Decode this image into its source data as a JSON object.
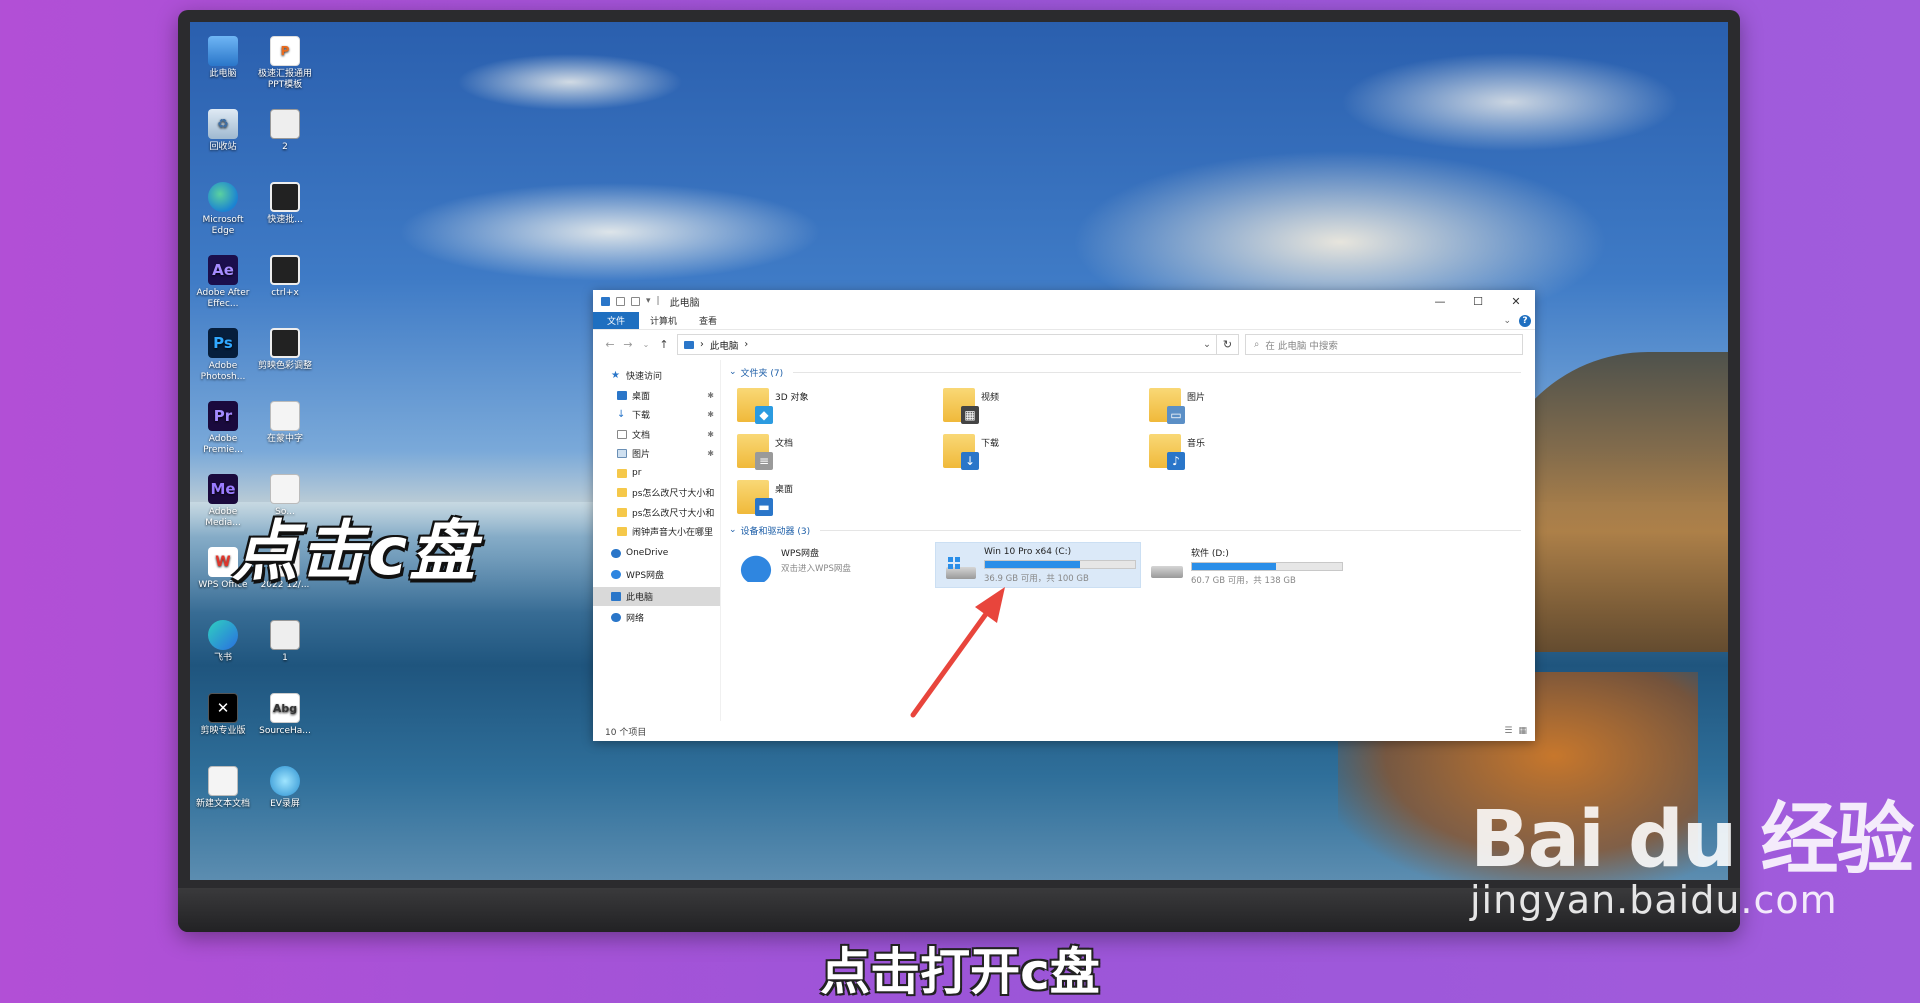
{
  "desktop_icons": [
    {
      "label": "此电脑",
      "icon": "pc",
      "glyph": ""
    },
    {
      "label": "极速汇报通用PPT模板",
      "icon": "ppt",
      "glyph": "P"
    },
    {
      "label": "回收站",
      "icon": "bin",
      "glyph": "♻"
    },
    {
      "label": "2",
      "icon": "img",
      "glyph": ""
    },
    {
      "label": "Microsoft Edge",
      "icon": "edge",
      "glyph": ""
    },
    {
      "label": "快速批...",
      "icon": "video",
      "glyph": ""
    },
    {
      "label": "Adobe After Effec...",
      "icon": "ae",
      "glyph": "Ae"
    },
    {
      "label": "ctrl+x",
      "icon": "video",
      "glyph": ""
    },
    {
      "label": "Adobe Photosh...",
      "icon": "ps",
      "glyph": "Ps"
    },
    {
      "label": "剪映色彩调整",
      "icon": "video",
      "glyph": ""
    },
    {
      "label": "Adobe Premie...",
      "icon": "pr",
      "glyph": "Pr"
    },
    {
      "label": "在蒙中字",
      "icon": "file",
      "glyph": ""
    },
    {
      "label": "Adobe Media...",
      "icon": "me",
      "glyph": "Me"
    },
    {
      "label": "So...",
      "icon": "file",
      "glyph": ""
    },
    {
      "label": "WPS Office",
      "icon": "wps",
      "glyph": "W"
    },
    {
      "label": "2022 12/...",
      "icon": "file",
      "glyph": ""
    },
    {
      "label": "飞书",
      "icon": "feishu",
      "glyph": ""
    },
    {
      "label": "1",
      "icon": "img",
      "glyph": ""
    },
    {
      "label": "剪映专业版",
      "icon": "capcut",
      "glyph": "✕"
    },
    {
      "label": "SourceHa...",
      "icon": "font",
      "glyph": "Abg"
    },
    {
      "label": "新建文本文档",
      "icon": "file",
      "glyph": ""
    },
    {
      "label": "EV录屏",
      "icon": "ev",
      "glyph": ""
    }
  ],
  "explorer": {
    "title": "此电脑",
    "ribbon_tabs": [
      "文件",
      "计算机",
      "查看"
    ],
    "help": "?",
    "address_path": "此电脑",
    "search_placeholder": "在 此电脑 中搜索",
    "sidebar": {
      "quick_access": "快速访问",
      "pinned": [
        {
          "label": "桌面",
          "icon": "blue"
        },
        {
          "label": "下载",
          "icon": "dl"
        },
        {
          "label": "文档",
          "icon": "doc"
        },
        {
          "label": "图片",
          "icon": "pic"
        }
      ],
      "recent": [
        "pr",
        "ps怎么改尺寸大小和",
        "ps怎么改尺寸大小和",
        "闹钟声音大小在哪里"
      ],
      "onedrive": "OneDrive",
      "wps_drive": "WPS网盘",
      "this_pc": "此电脑",
      "network": "网络"
    },
    "folders_header": "文件夹 (7)",
    "folders": [
      {
        "label": "3D 对象",
        "badge": "◆",
        "badge_color": "#2b9be0"
      },
      {
        "label": "视频",
        "badge": "▦",
        "badge_color": "#444444"
      },
      {
        "label": "图片",
        "badge": "▭",
        "badge_color": "#5b8fc6"
      },
      {
        "label": "文档",
        "badge": "≡",
        "badge_color": "#9a9a9a"
      },
      {
        "label": "下载",
        "badge": "↓",
        "badge_color": "#2a76c9"
      },
      {
        "label": "音乐",
        "badge": "♪",
        "badge_color": "#2a76c9"
      },
      {
        "label": "桌面",
        "badge": "▬",
        "badge_color": "#2a76c9"
      }
    ],
    "drives_header": "设备和驱动器 (3)",
    "wps": {
      "name": "WPS网盘",
      "desc": "双击进入WPS网盘"
    },
    "drive_c": {
      "name": "Win 10 Pro x64 (C:)",
      "desc": "36.9 GB 可用，共 100 GB",
      "used_fraction": 0.631
    },
    "drive_d": {
      "name": "软件 (D:)",
      "desc": "60.7 GB 可用，共 138 GB",
      "used_fraction": 0.56
    },
    "status": "10 个项目"
  },
  "overlay_caption": "点击c盘",
  "subtitle": "点击打开c盘",
  "watermark": {
    "brand": "Bai du 经验",
    "url": "jingyan.baidu.com"
  },
  "colors": {
    "accent": "#1e6fc0",
    "arrow": "#e8453c",
    "bar_fill": "#2a8ee8"
  }
}
